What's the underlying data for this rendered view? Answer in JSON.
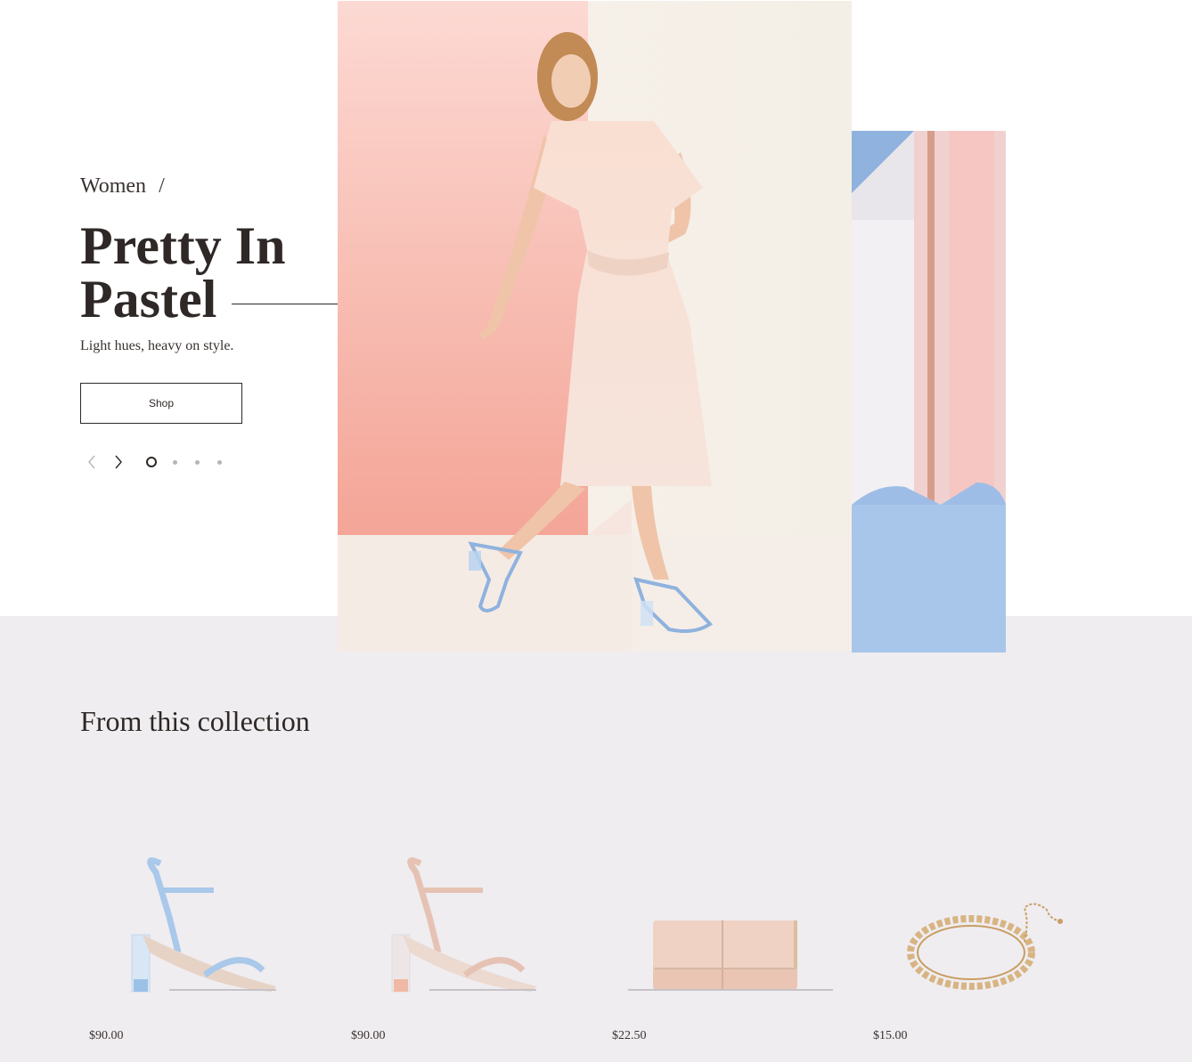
{
  "hero": {
    "breadcrumb": "Women",
    "breadcrumb_separator": "/",
    "title_line1": "Pretty In",
    "title_line2": "Pastel",
    "subtitle": "Light hues, heavy on style.",
    "shop_label": "Shop",
    "slides": {
      "count": 4,
      "active": 1
    }
  },
  "collection": {
    "title": "From this collection",
    "products": [
      {
        "icon": "blue-heel-sandal-image",
        "price": "$90.00"
      },
      {
        "icon": "blush-heel-sandal-image",
        "price": "$90.00"
      },
      {
        "icon": "blush-clutch-image",
        "price": "$22.50"
      },
      {
        "icon": "gold-choker-image",
        "price": "$15.00"
      }
    ]
  },
  "colors": {
    "text": "#2e2826",
    "band": "#efedf0",
    "pastel_pink": "#f6b3a9",
    "pastel_blue": "#a9c6ea"
  }
}
